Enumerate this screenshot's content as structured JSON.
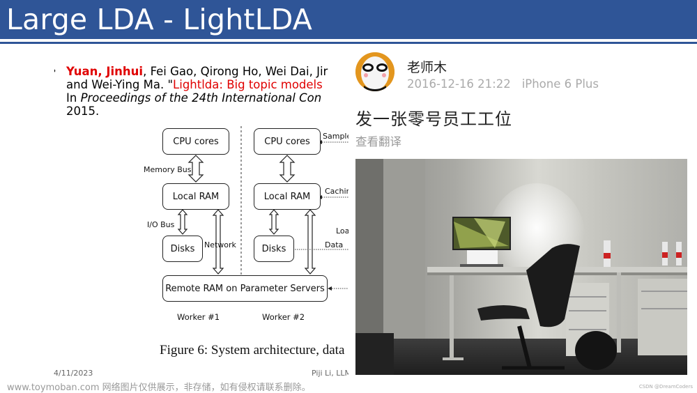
{
  "slide": {
    "title": "Large LDA - LightLDA",
    "citation": {
      "author_highlight": "Yuan, Jinhui",
      "authors_rest": ", Fei Gao, Qirong Ho, Wei Dai, Jir",
      "line2_prefix": "and Wei-Ying Ma. \"",
      "paper_title": "Lightlda: Big topic models",
      "line3_prefix": "In ",
      "venue": "Proceedings of the 24th International Con",
      "year": "2015."
    },
    "figure": {
      "boxes": {
        "cpu1": "CPU cores",
        "cpu2": "CPU cores",
        "ram1": "Local RAM",
        "ram2": "Local RAM",
        "disk1": "Disks",
        "disk2": "Disks",
        "remote": "Remote RAM on Parameter Servers"
      },
      "labels": {
        "memory_bus": "Memory Bus",
        "io_bus": "I/O Bus",
        "network": "Network",
        "sample": "Sample",
        "caching": "Cachin",
        "load": "Loa",
        "data": "Data"
      },
      "workers": [
        "Worker #1",
        "Worker #2"
      ],
      "caption": "Figure 6: System architecture, data"
    },
    "footer": {
      "date": "4/11/2023",
      "author": "Piji Li, LLM"
    }
  },
  "post": {
    "username": "老师木",
    "timestamp": "2016-12-16 21:22",
    "device": "iPhone 6 Plus",
    "text": "发一张零号员工工位",
    "translate_link": "查看翻译",
    "photo_alt": "Office desk with monitor and black chair"
  },
  "watermark": "www.toymoban.com 网络图片仅供展示，非存储，如有侵权请联系删除。",
  "credit": "CSDN @DreamCoders",
  "colors": {
    "header": "#2f5597",
    "highlight": "#e00000"
  }
}
